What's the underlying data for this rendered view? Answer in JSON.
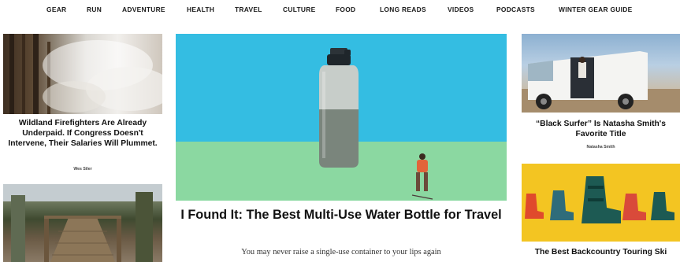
{
  "nav": {
    "items": [
      "GEAR",
      "RUN",
      "ADVENTURE",
      "HEALTH",
      "TRAVEL",
      "CULTURE",
      "FOOD",
      "LONG READS",
      "VIDEOS",
      "PODCASTS",
      "WINTER GEAR GUIDE"
    ]
  },
  "left": {
    "story1": {
      "headline": "Wildland Firefighters Are Already Underpaid. If Congress Doesn't Intervene, Their Salaries Will Plummet.",
      "byline": "Wes Siler"
    }
  },
  "featured": {
    "headline": "I Found It: The Best Multi-Use Water Bottle for Travel",
    "dek": "You may never raise a single-use container to your lips again"
  },
  "right": {
    "story1": {
      "headline": "“Black Surfer” Is Natasha Smith's Favorite Title",
      "byline": "Natasha Smith"
    },
    "story2": {
      "headline": "The Best Backcountry Touring Ski"
    }
  },
  "colors": {
    "hero_sky": "#34bde2",
    "hero_ground": "#8bd8a1",
    "boots_background": "#f3c522"
  }
}
